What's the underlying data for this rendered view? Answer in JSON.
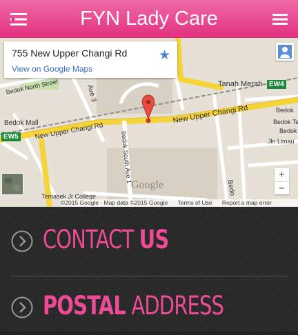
{
  "header": {
    "title": "FYN Lady Care",
    "left_icon": "list-menu-icon",
    "right_icon": "hamburger-menu-icon"
  },
  "map": {
    "infobox": {
      "address": "755 New Upper Changi Rd",
      "link": "View on Google Maps",
      "star_icon": "star-icon"
    },
    "labels": {
      "bedok_north_street": "Bedok North Street",
      "tanah_merah": "Tanah Merah",
      "ew4": "EW4",
      "ew5": "EW5",
      "bedok_mall": "Bedok Mall",
      "new_upper_changi_left": "New Upper Changi Rd",
      "new_upper_changi_right": "New Upper Changi Rd",
      "bedok_south_ave": "Bedok South Ave 1",
      "ave3": "Ave 3",
      "bedok_right_1": "Bedok",
      "bedok_right_2": "Bedok Ter",
      "bedok_right_3": "Bedok",
      "jln_limau": "Jln Limau",
      "bedo_vert": "Bedo",
      "temasek": "Temasek Jr College",
      "google": "Google"
    },
    "zoom_in": "+",
    "zoom_out": "−",
    "attribution": {
      "copyright": "©2015 Google - Map data ©2015 Google",
      "terms": "Terms of Use",
      "report": "Report a map error"
    }
  },
  "sections": [
    {
      "thin": "CONTACT",
      "bold": "US"
    },
    {
      "bold": "POSTAL",
      "thin": "ADDRESS"
    }
  ],
  "colors": {
    "accent": "#ee4b96",
    "header_top": "#f06aa7",
    "header_bottom": "#e2307f",
    "road": "#f5d33a"
  }
}
